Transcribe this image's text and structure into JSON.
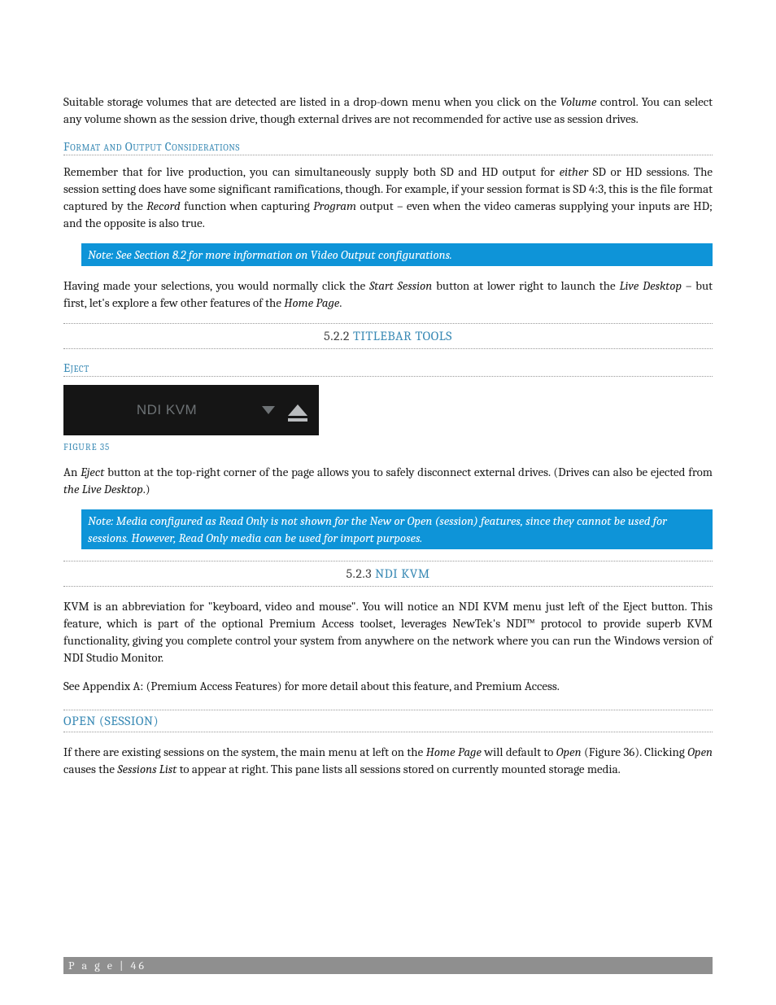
{
  "para1": {
    "t1": "Suitable storage volumes that are detected are listed in a drop-down menu when you click on the ",
    "i1": "Volume",
    "t2": " control.  You can select any volume shown as the session drive, though external drives are not recommended for active use as session drives."
  },
  "subhead_format": "Format and Output Considerations",
  "para2": {
    "t1": "Remember that for live production, you can simultaneously supply both SD and HD output for ",
    "i1": "either",
    "t2": " SD or HD sessions. The session setting does have some significant ramifications, though. For example, if your session format is SD 4:3, this is the file format captured by the ",
    "i2": "Record",
    "t3": " function when capturing ",
    "i3": "Program",
    "t4": " output – even when the video cameras supplying your inputs are HD; and the opposite is also true."
  },
  "note1": "Note: See Section 8.2 for more information on Video Output configurations.",
  "para3": {
    "t1": "Having made your selections, you would normally click the ",
    "i1": "Start Session",
    "t2": " button at lower right to launch the ",
    "i2": "Live Desktop",
    "t3": " – but first, let's explore a few other features of the ",
    "i3": "Home Page",
    "t4": "."
  },
  "head_titlebar": {
    "num": "5.2.2 ",
    "title": "TITLEBAR TOOLS"
  },
  "subhead_eject": "Eject",
  "figure35": {
    "ndi": "NDI KVM",
    "caption": "FIGURE 35"
  },
  "para_eject": {
    "t1": "An ",
    "i1": "Eject",
    "t2": " button at the top-right corner of the page allows you to safely disconnect external drives.  (Drives can also be ejected from ",
    "i2": "the Live Desktop",
    "t3": ".)"
  },
  "note2": "Note: Media configured as Read Only is not shown for the New or Open (session) features, since they cannot be used for sessions.  However, Read Only media can be used for import purposes.",
  "head_ndikvm": {
    "num": "5.2.3 ",
    "title": "NDI KVM"
  },
  "para_kvm": "KVM is an abbreviation for \"keyboard, video and mouse\".  You will notice an NDI KVM menu just left of the Eject button.  This feature, which is part of the optional Premium Access toolset, leverages NewTek's NDI™ protocol to provide superb KVM functionality, giving you complete control your system from anywhere on the network where you can run the Windows version of NDI Studio Monitor.",
  "para_appendix": "See Appendix A: (Premium Access Features) for more detail about this feature, and Premium Access.",
  "head_open": "OPEN (SESSION)",
  "para_open": {
    "t1": "If there are existing sessions on the system, the main menu at left on the ",
    "i1": "Home Page",
    "t2": " will default to ",
    "i2": "Open",
    "t3": " (Figure 36). Clicking ",
    "i3": "Open",
    "t4": " causes the ",
    "i4": "Sessions List",
    "t5": " to appear at right.  This pane lists all sessions stored on currently mounted storage media."
  },
  "footer": "P a g e  | 46"
}
